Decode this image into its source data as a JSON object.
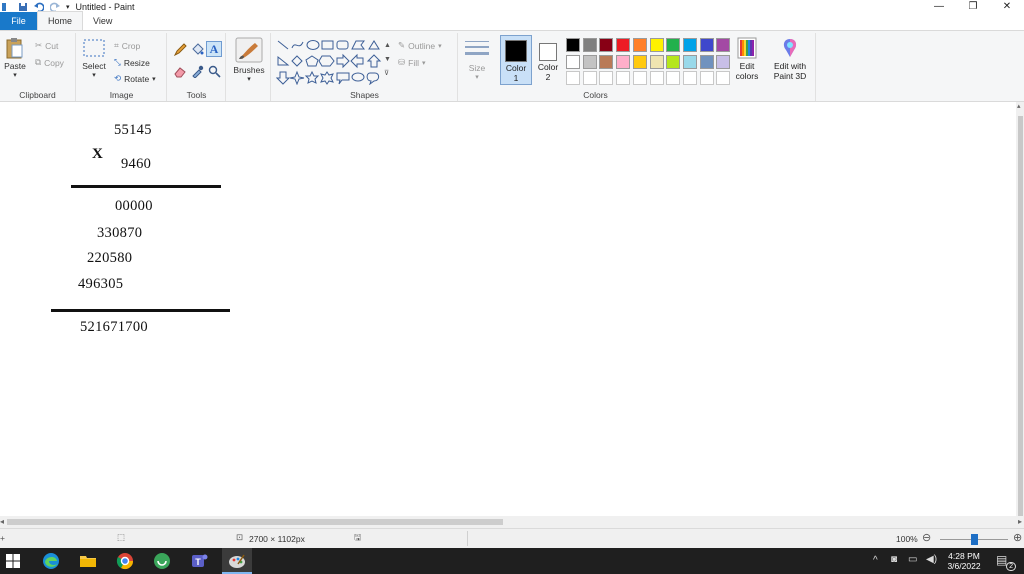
{
  "window": {
    "title": "Untitled - Paint",
    "controls": [
      "minimize-icon",
      "restore-icon",
      "close-icon"
    ]
  },
  "tabs": [
    {
      "label": "File"
    },
    {
      "label": "Home"
    },
    {
      "label": "View"
    }
  ],
  "ribbon": {
    "clipboard": {
      "paste": "Paste",
      "cut": "Cut",
      "copy": "Copy",
      "group": "Clipboard"
    },
    "image": {
      "select": "Select",
      "crop": "Crop",
      "resize": "Resize",
      "rotate": "Rotate",
      "group": "Image"
    },
    "tools": {
      "group": "Tools"
    },
    "brushes": {
      "label": "Brushes"
    },
    "shapes": {
      "outline": "Outline",
      "fill": "Fill",
      "group": "Shapes"
    },
    "size": {
      "label": "Size"
    },
    "colors": {
      "color1": "Color 1",
      "color1_line1": "Color",
      "color1_line2": "1",
      "color2_line1": "Color",
      "color2_line2": "2",
      "edit_colors_line1": "Edit",
      "edit_colors_line2": "colors",
      "paint3d_line1": "Edit with",
      "paint3d_line2": "Paint 3D",
      "group": "Colors",
      "color1_value": "#000000",
      "color2_value": "#ffffff",
      "palette_row1": [
        "#000000",
        "#7f7f7f",
        "#880015",
        "#ed1c24",
        "#ff7f27",
        "#fff200",
        "#22b14c",
        "#00a2e8",
        "#3f48cc",
        "#a349a4"
      ],
      "palette_row2": [
        "#ffffff",
        "#c3c3c3",
        "#b97a57",
        "#ffaec9",
        "#ffc90e",
        "#efe4b0",
        "#b5e61d",
        "#99d9ea",
        "#7092be",
        "#c8bfe7"
      ]
    }
  },
  "canvas": {
    "multiplicand": "55145",
    "operator": "X",
    "multiplier": "9460",
    "partial1": "00000",
    "partial2": "330870",
    "partial3": "220580",
    "partial4": "496305",
    "result": "521671700"
  },
  "status": {
    "canvas_size": "2700 × 1102px",
    "zoom": "100%",
    "zoom_level": 0.5
  },
  "taskbar": {
    "time": "4:28 PM",
    "date": "3/6/2022",
    "notification_count": "2"
  }
}
